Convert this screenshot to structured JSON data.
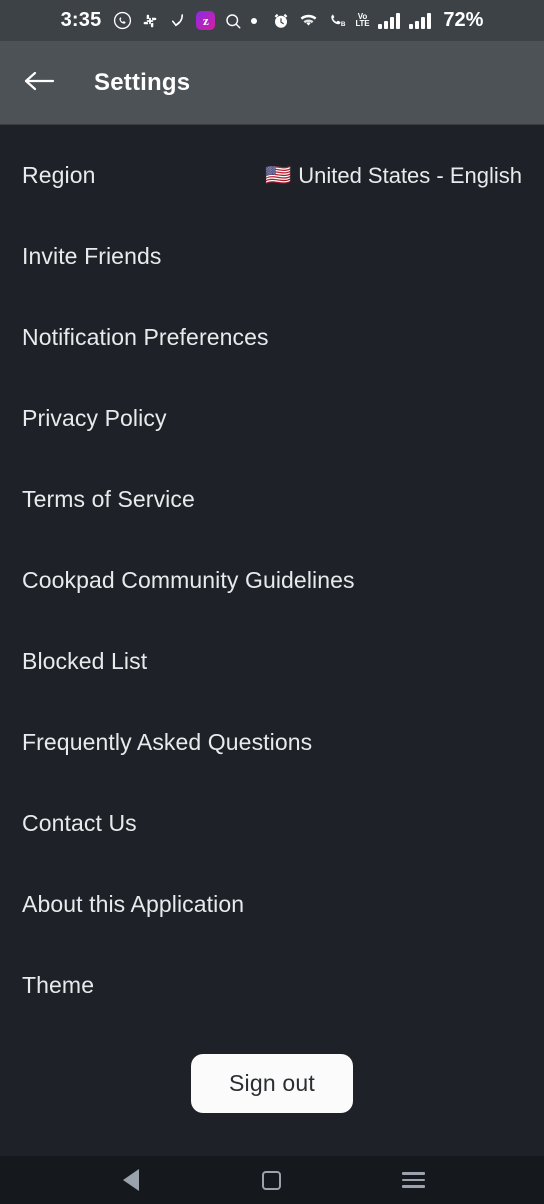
{
  "status_bar": {
    "time": "3:35",
    "battery": "72%",
    "icons": [
      {
        "name": "whatsapp-icon",
        "label": "WhatsApp"
      },
      {
        "name": "slack-icon",
        "label": "Slack"
      },
      {
        "name": "curved-arrow-icon",
        "label": "Arrow"
      },
      {
        "name": "zoom-icon",
        "label": "z",
        "color": "#8a2be2"
      },
      {
        "name": "search-icon",
        "label": "Search"
      },
      {
        "name": "dot-icon",
        "label": "Dot"
      },
      {
        "name": "alarm-clock-icon",
        "label": "Alarm"
      },
      {
        "name": "wifi-icon",
        "label": "Wi-Fi"
      },
      {
        "name": "call-icon",
        "label": "Call B"
      },
      {
        "name": "volte-icon",
        "label_top": "Vo",
        "label_bottom": "LTE"
      },
      {
        "name": "signal-bars-icon-1",
        "label": "Signal 1"
      },
      {
        "name": "signal-bars-icon-2",
        "label": "Signal 2"
      }
    ]
  },
  "app_bar": {
    "title": "Settings",
    "back_icon": "arrow-left-icon"
  },
  "settings": {
    "region": {
      "label": "Region",
      "flag": "🇺🇸",
      "value": "United States - English"
    },
    "items": [
      {
        "label": "Invite Friends"
      },
      {
        "label": "Notification Preferences"
      },
      {
        "label": "Privacy Policy"
      },
      {
        "label": "Terms of Service"
      },
      {
        "label": "Cookpad Community Guidelines"
      },
      {
        "label": "Blocked List"
      },
      {
        "label": "Frequently Asked Questions"
      },
      {
        "label": "Contact Us"
      },
      {
        "label": "About this Application"
      },
      {
        "label": "Theme"
      }
    ],
    "sign_out_label": "Sign out"
  },
  "nav_bar": {
    "back": "back-triangle-icon",
    "home": "home-square-icon",
    "recents": "recents-menu-icon"
  },
  "colors": {
    "status_bar_bg": "#3d4247",
    "app_bar_bg": "#4d5256",
    "content_bg": "#1e2228",
    "nav_bar_bg": "#15191e",
    "text": "#e8eaec",
    "button_bg": "#fbfbfb"
  }
}
